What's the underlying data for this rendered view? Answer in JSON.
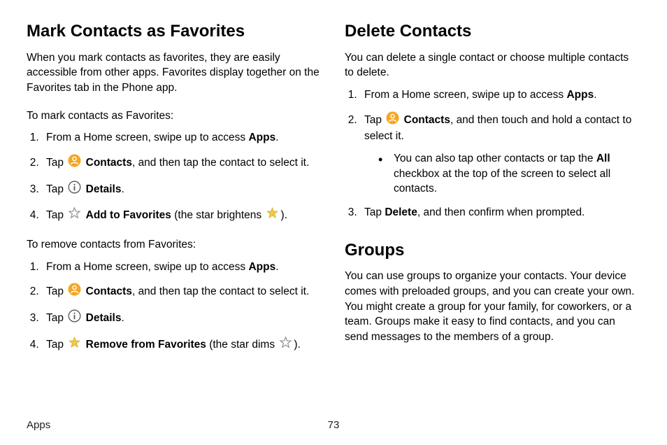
{
  "left": {
    "title": "Mark Contacts as Favorites",
    "intro": "When you mark contacts as favorites, they are easily accessible from other apps. Favorites display together on the Favorites tab in the Phone app.",
    "mark_sub": "To mark contacts as Favorites:",
    "mark_steps": {
      "s1a": "From a Home screen, swipe up to access ",
      "s1b": "Apps",
      "s1c": ".",
      "s2a": "Tap ",
      "s2b": "Contacts",
      "s2c": ", and then tap the contact to select it.",
      "s3a": "Tap ",
      "s3b": "Details",
      "s3c": ".",
      "s4a": "Tap ",
      "s4b": "Add to Favorites",
      "s4c": " (the star brightens ",
      "s4d": ")."
    },
    "remove_sub": "To remove contacts from Favorites:",
    "remove_steps": {
      "s1a": "From a Home screen, swipe up to access ",
      "s1b": "Apps",
      "s1c": ".",
      "s2a": "Tap ",
      "s2b": "Contacts",
      "s2c": ", and then tap the contact to select it.",
      "s3a": "Tap ",
      "s3b": "Details",
      "s3c": ".",
      "s4a": "Tap ",
      "s4b": "Remove from Favorites",
      "s4c": " (the star dims ",
      "s4d": ")."
    }
  },
  "right": {
    "delete": {
      "title": "Delete Contacts",
      "intro": "You can delete a single contact or choose multiple contacts to delete.",
      "s1a": "From a Home screen, swipe up to access ",
      "s1b": "Apps",
      "s1c": ".",
      "s2a": "Tap ",
      "s2b": "Contacts",
      "s2c": ", and then touch and hold a contact to select it.",
      "bullet_a": "You can also tap other contacts or tap the ",
      "bullet_b": "All",
      "bullet_c": " checkbox at the top of the screen to select all contacts.",
      "s3a": "Tap ",
      "s3b": "Delete",
      "s3c": ", and then confirm when prompted."
    },
    "groups": {
      "title": "Groups",
      "intro": "You can use groups to organize your contacts. Your device comes with preloaded groups, and you can create your own. You might create a group for your family, for coworkers, or a team. Groups make it easy to find contacts, and you can send messages to the members of a group."
    }
  },
  "footer": {
    "section": "Apps",
    "page": "73"
  }
}
